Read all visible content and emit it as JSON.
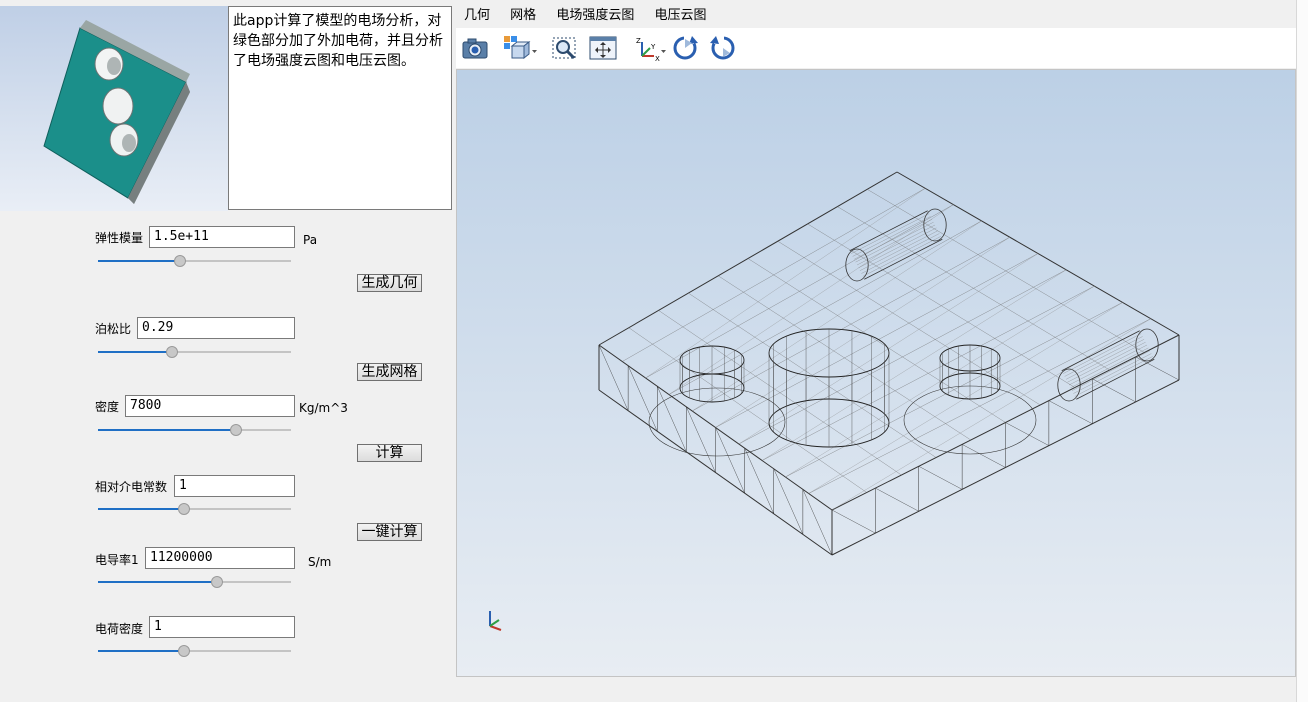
{
  "description": "此app计算了模型的电场分析，对绿色部分加了外加电荷，并且分析了电场强度云图和电压云图。",
  "params": [
    {
      "label": "弹性模量",
      "value": "1.5e+11",
      "unit": "Pa",
      "slider": 0.42
    },
    {
      "label": "泊松比",
      "value": "0.29",
      "unit": "",
      "slider": 0.38
    },
    {
      "label": "密度",
      "value": "7800",
      "unit": "Kg/m^3",
      "slider": 0.71
    },
    {
      "label": "相对介电常数",
      "value": "1",
      "unit": "",
      "slider": 0.44
    },
    {
      "label": "电导率1",
      "value": "11200000",
      "unit": "S/m",
      "slider": 0.61
    },
    {
      "label": "电荷密度",
      "value": "1",
      "unit": "",
      "slider": 0.44
    }
  ],
  "buttons": {
    "geometry": "生成几何",
    "mesh": "生成网格",
    "compute": "计算",
    "one_click": "一键计算"
  },
  "tabs": [
    "几何",
    "网格",
    "电场强度云图",
    "电压云图"
  ],
  "toolbar": [
    "camera-icon",
    "view-cube-icon",
    "zoom-box-icon",
    "zoom-extents-icon",
    "axes-orientation-icon",
    "rotate-cw-icon",
    "rotate-ccw-icon"
  ],
  "colors": {
    "model_teal": "#1b8f8a",
    "accent_blue": "#1f6fc5"
  }
}
